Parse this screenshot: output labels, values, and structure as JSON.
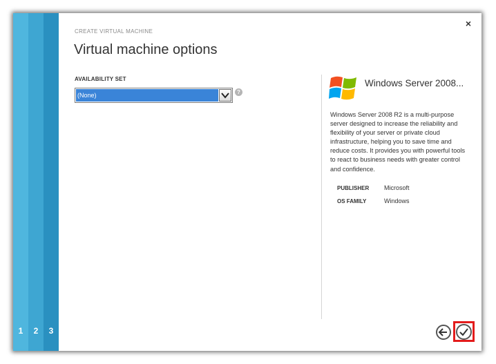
{
  "header": {
    "subtitle": "CREATE VIRTUAL MACHINE",
    "title": "Virtual machine options"
  },
  "steps": [
    "1",
    "2",
    "3"
  ],
  "form": {
    "availability_set_label": "AVAILABILITY SET",
    "availability_set_value": "(None)",
    "help_glyph": "?"
  },
  "info": {
    "os_name": "Windows Server 2008...",
    "description": "Windows Server 2008 R2 is a multi-purpose server designed to increase the reliability and flexibility of your server or private cloud infrastructure, helping you to save time and reduce costs. It provides you with powerful tools to react to business needs with greater control and confidence.",
    "meta": [
      {
        "key": "PUBLISHER",
        "value": "Microsoft"
      },
      {
        "key": "OS FAMILY",
        "value": "Windows"
      }
    ]
  },
  "close_glyph": "×",
  "colors": {
    "rail_1": "#4fb6de",
    "rail_2": "#3ea6d2",
    "rail_3": "#2a90c0",
    "selected_blue": "#3a84d8",
    "highlight_red": "#e31b1b"
  },
  "icons": {
    "close": "close-icon",
    "help": "help-icon",
    "back": "arrow-left-icon",
    "confirm": "checkmark-icon",
    "logo": "windows-logo-icon"
  }
}
